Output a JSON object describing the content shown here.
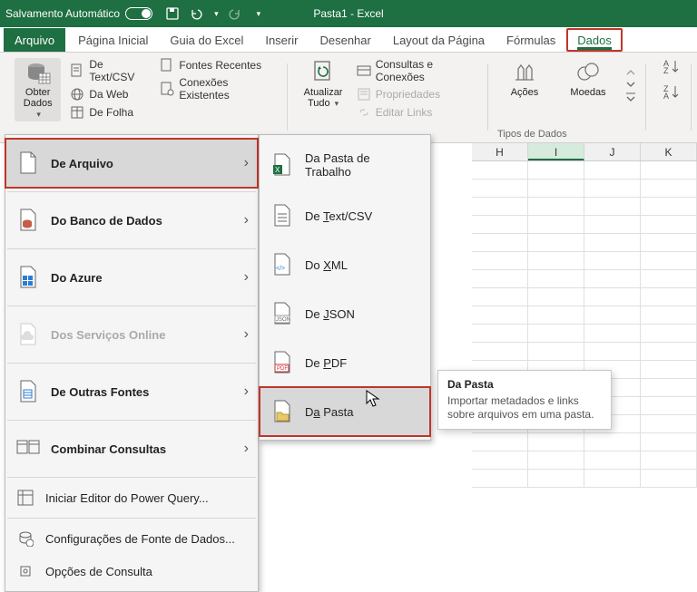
{
  "titlebar": {
    "autosave": "Salvamento Automático",
    "doctitle": "Pasta1 - Excel"
  },
  "tabs": {
    "file": "Arquivo",
    "home": "Página Inicial",
    "guide": "Guia do Excel",
    "insert": "Inserir",
    "draw": "Desenhar",
    "layout": "Layout da Página",
    "formulas": "Fórmulas",
    "data": "Dados"
  },
  "ribbon": {
    "obter_line1": "Obter",
    "obter_line2": "Dados",
    "textcsv": "De Text/CSV",
    "web": "Da Web",
    "folha": "De  Folha",
    "recentes": "Fontes Recentes",
    "existentes": "Conexões Existentes",
    "atualizar_line1": "Atualizar",
    "atualizar_line2": "Tudo",
    "consultas_conexoes": "Consultas e Conexões",
    "propriedades": "Propriedades",
    "editar_links": "Editar Links",
    "acoes": "Ações",
    "moedas": "Moedas",
    "tipos_dados": "Tipos de Dados"
  },
  "menu1": {
    "de_arquivo": "De Arquivo",
    "banco_dados": "Do Banco de Dados",
    "azure": "Do Azure",
    "servicos_online": "Dos Serviços Online",
    "outras_fontes": "De Outras Fontes",
    "combinar_consultas": "Combinar Consultas",
    "power_query": "Iniciar Editor do Power Query...",
    "config_fonte": "Configurações de Fonte de Dados...",
    "opcoes_consulta": "Opções de Consulta"
  },
  "menu2": {
    "pasta_trabalho": "Da Pasta de Trabalho",
    "textcsv_pre": "De ",
    "textcsv_u": "T",
    "textcsv_post": "ext/CSV",
    "xml_pre": "Do ",
    "xml_u": "X",
    "xml_post": "ML",
    "json_pre": "De ",
    "json_u": "J",
    "json_post": "SON",
    "pdf_pre": "De ",
    "pdf_u": "P",
    "pdf_post": "DF",
    "pasta_pre": "D",
    "pasta_u": "a",
    "pasta_post": " Pasta"
  },
  "tooltip": {
    "title": "Da Pasta",
    "body": "Importar metadados e links sobre arquivos em uma pasta."
  },
  "columns": [
    "H",
    "I",
    "J",
    "K"
  ]
}
